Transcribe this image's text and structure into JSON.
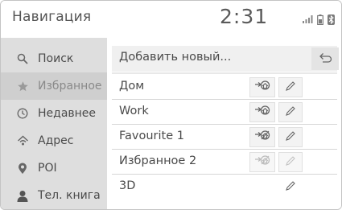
{
  "header": {
    "title": "Навигация",
    "clock": "2:31"
  },
  "sidebar": {
    "items": [
      {
        "label": "Поиск",
        "icon": "search-icon"
      },
      {
        "label": "Избранное",
        "icon": "star-icon",
        "active": true
      },
      {
        "label": "Недавнее",
        "icon": "clock-icon"
      },
      {
        "label": "Адрес",
        "icon": "address-icon"
      },
      {
        "label": "POI",
        "icon": "poi-pin-icon"
      },
      {
        "label": "Тел. книга",
        "icon": "contacts-icon"
      }
    ]
  },
  "favorites": {
    "add_label": "Добавить новый...",
    "back_icon": "back-icon",
    "rows": [
      {
        "label": "Дом",
        "home_button": "enabled",
        "edit_button": "enabled"
      },
      {
        "label": "Work",
        "home_button": "enabled",
        "edit_button": "enabled"
      },
      {
        "label": "Favourite 1",
        "home_button": "enabled",
        "edit_button": "enabled"
      },
      {
        "label": "Избранное 2",
        "home_button": "disabled",
        "edit_button": "disabled"
      },
      {
        "label": "3D",
        "home_button": "none",
        "edit_button": "enabled"
      }
    ]
  },
  "colors": {
    "sidebar_bg": "#dedede",
    "sidebar_active": "#cfcfcf",
    "text": "#4a4a4a",
    "disabled": "#b5b5b5"
  }
}
